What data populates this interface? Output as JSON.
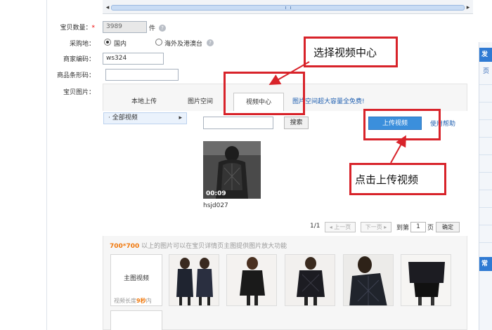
{
  "scrollbar": {
    "left_arrow": "◂",
    "right_arrow": "▸"
  },
  "form": {
    "qty_label": "宝贝数量：",
    "required_mark": "*",
    "qty_value": "3989",
    "qty_unit": "件",
    "origin_label": "采购地：",
    "origin_domestic": "国内",
    "origin_overseas": "海外及港澳台",
    "merchant_code_label": "商家编码：",
    "merchant_code_value": "ws324",
    "barcode_label": "商品条形码：",
    "barcode_value": "",
    "pictures_label": "宝贝图片："
  },
  "tabs": {
    "local_upload": "本地上传",
    "picture_space": "图片空间",
    "video_center": "视频中心",
    "upgrade_link": "图片空间超大容量全免费!"
  },
  "video_center": {
    "folder": "· 全部视频",
    "folder_arrow": "▸",
    "search_placeholder": "",
    "search_button": "搜索",
    "upload_button": "上传视频",
    "help_link": "使用帮助",
    "video_duration": "00:09",
    "video_name": "hsjd027",
    "page_indicator": "1/1",
    "prev_page": "◂ 上一页",
    "next_page": "下一页 ▸",
    "goto_prefix": "到第",
    "page_value": "1",
    "page_suffix": "页",
    "confirm": "确定"
  },
  "pictures": {
    "tip_size": "700*700",
    "tip_text": " 以上的图片可以在宝贝详情页主图提供图片放大功能",
    "main_video": "主图视频",
    "video_length_prefix": "视频长度",
    "video_length_value": "9秒",
    "video_length_suffix": "内"
  },
  "right_panel": {
    "tab1": "发布",
    "text1": "页",
    "tab2": "常"
  },
  "annotations": {
    "select_video_center": "选择视频中心",
    "click_upload_video": "点击上传视频"
  },
  "colors": {
    "annotation_red": "#d8232a",
    "upload_blue": "#3b8fdc",
    "link_blue": "#1f5fb0"
  }
}
